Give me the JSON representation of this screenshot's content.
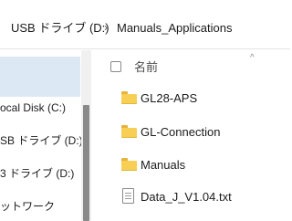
{
  "breadcrumb": {
    "drive": "USB ドライブ (D:)",
    "separator": "›",
    "folder": "Manuals_Applications"
  },
  "nav": {
    "items": [
      {
        "label": "ocal Disk (C:)"
      },
      {
        "label": "SB ドライブ (D:)"
      },
      {
        "label": "3 ドライブ (D:)"
      },
      {
        "label": "ットワーク"
      }
    ]
  },
  "list_header": {
    "name_label": "名前",
    "sort_glyph": "^"
  },
  "files": [
    {
      "name": "GL28-APS",
      "icon": "folder-icon"
    },
    {
      "name": "GL-Connection",
      "icon": "folder-icon"
    },
    {
      "name": "Manuals",
      "icon": "folder-icon"
    },
    {
      "name": "Data_J_V1.04.txt",
      "icon": "text-file-icon"
    }
  ],
  "colors": {
    "selection": "#dde8f5",
    "folder": "#f7cf55",
    "scroll_thumb": "#8a8a8a"
  }
}
